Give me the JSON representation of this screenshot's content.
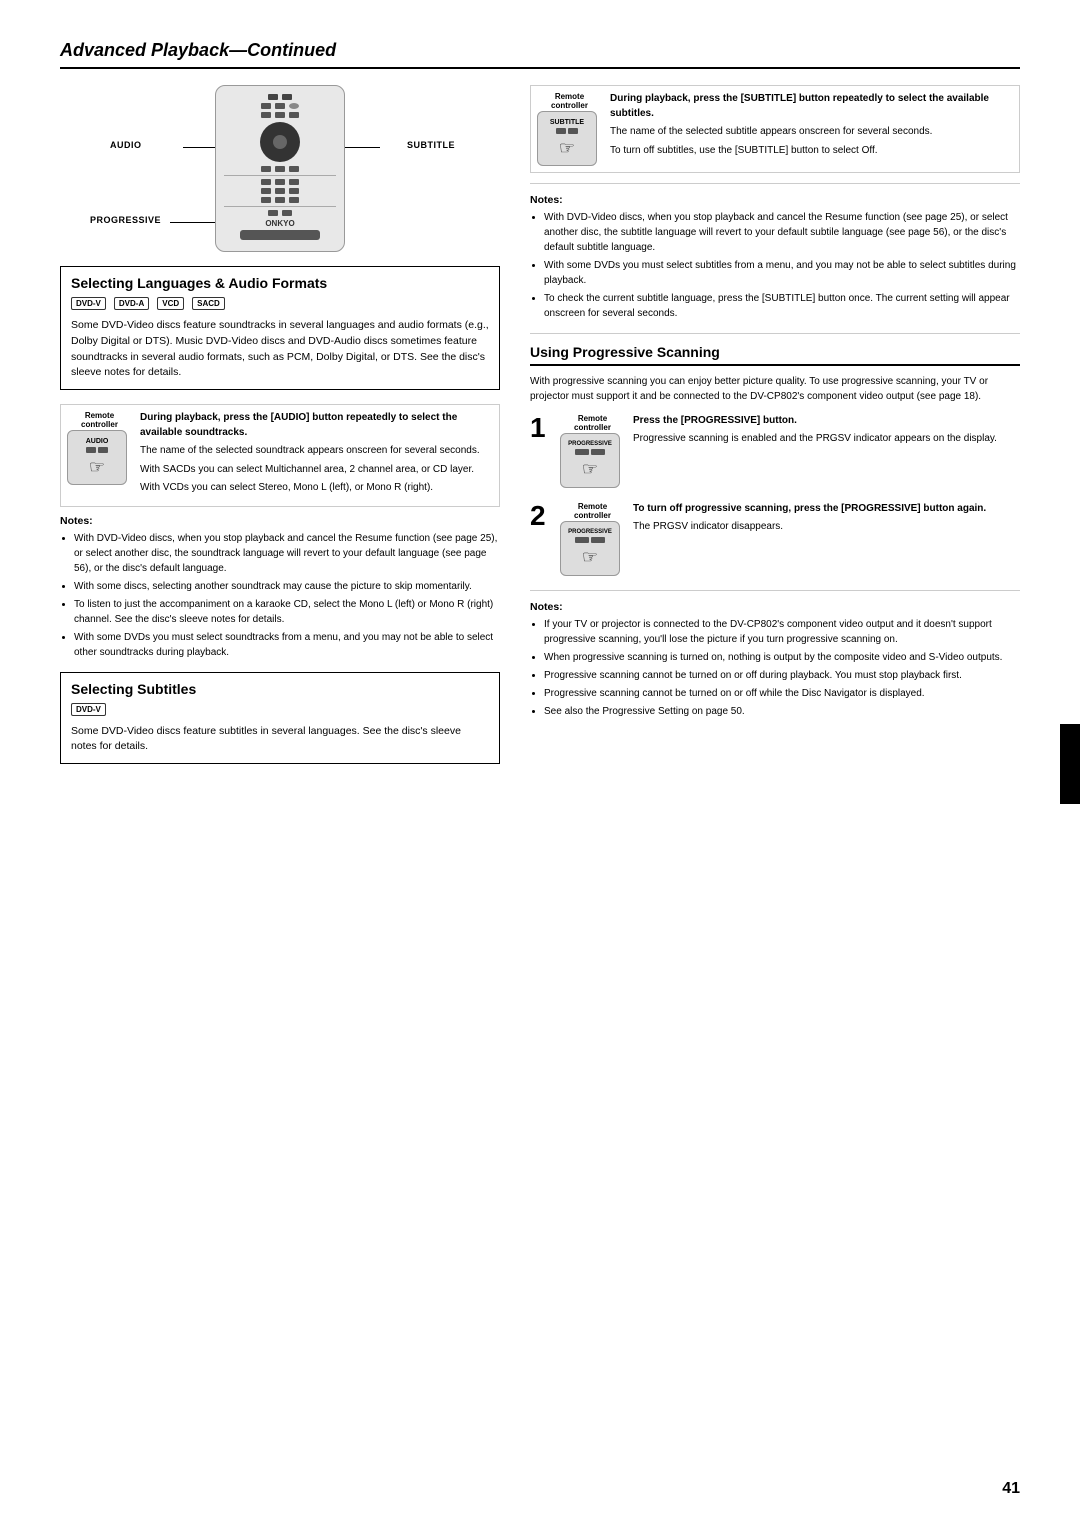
{
  "page": {
    "header": "Advanced Playback",
    "header_continued": "—Continued",
    "page_number": "41"
  },
  "remote_labels": {
    "audio": "AUDIO",
    "subtitle": "SUBTITLE",
    "progressive": "PROGRESSIVE"
  },
  "selecting_section": {
    "title": "Selecting Languages & Audio Formats",
    "disc_icons": [
      "DVD-V",
      "DVD-A",
      "VCD",
      "SACD"
    ],
    "intro_text": "Some DVD-Video discs feature soundtracks in several languages and audio formats (e.g., Dolby Digital or DTS). Music DVD-Video discs and DVD-Audio discs sometimes feature soundtracks in several audio formats, such as PCM, Dolby Digital, or DTS. See the disc's sleeve notes for details.",
    "audio_remote_block": {
      "label": "Remote controller",
      "btn_label": "AUDIO",
      "instruction_bold": "During playback, press the [AUDIO] button repeatedly to select the available soundtracks.",
      "detail_1": "The name of the selected soundtrack appears onscreen for several seconds.",
      "detail_2": "With SACDs you can select Multichannel area, 2 channel area, or CD layer.",
      "detail_3": "With VCDs you can select Stereo, Mono L (left), or Mono R (right)."
    }
  },
  "audio_notes": {
    "title": "Notes:",
    "items": [
      "With DVD-Video discs, when you stop playback and cancel the Resume function (see page 25), or select another disc, the soundtrack language will revert to your default language (see page 56), or the disc's default language.",
      "With some discs, selecting another soundtrack may cause the picture to skip momentarily.",
      "To listen to just the accompaniment on a karaoke CD, select the Mono L (left) or Mono R (right) channel. See the disc's sleeve notes for details.",
      "With some DVDs you must select soundtracks from a menu, and you may not be able to select other soundtracks during playback."
    ]
  },
  "selecting_subtitles": {
    "title": "Selecting Subtitles",
    "disc_icons": [
      "DVD-V"
    ],
    "intro_text": "Some DVD-Video discs feature subtitles in several languages. See the disc's sleeve notes for details."
  },
  "subtitle_remote_block": {
    "label": "Remote controller",
    "btn_label": "SUBTITLE",
    "instruction_bold": "During playback, press the [SUBTITLE] button repeatedly to select the available subtitles.",
    "detail_1": "The name of the selected subtitle appears onscreen for several seconds.",
    "detail_2": "To turn off subtitles, use the [SUBTITLE] button to select Off."
  },
  "subtitle_notes": {
    "title": "Notes:",
    "items": [
      "With DVD-Video discs, when you stop playback and cancel the Resume function (see page 25), or select another disc, the subtitle language will revert to your default subtile language (see page 56), or the disc's default subtitle language.",
      "With some DVDs you must select subtitles from a menu, and you may not be able to select subtitles during playback.",
      "To check the current subtitle language, press the [SUBTITLE] button once. The current setting will appear onscreen for several seconds."
    ]
  },
  "using_progressive": {
    "title": "Using Progressive Scanning",
    "intro_text": "With progressive scanning you can enjoy better picture quality. To use progressive scanning, your TV or projector must support it and be connected to the DV-CP802's component video output (see page 18).",
    "step1": {
      "number": "1",
      "label": "Remote controller",
      "btn_label": "PROGRESSIVE",
      "instruction_bold": "Press the [PROGRESSIVE] button.",
      "detail": "Progressive scanning is enabled and the PRGSV indicator appears on the display."
    },
    "step2": {
      "number": "2",
      "label": "Remote controller",
      "btn_label": "PROGRESSIVE",
      "instruction_bold": "To turn off progressive scanning, press the [PROGRESSIVE] button again.",
      "detail": "The PRGSV indicator disappears."
    }
  },
  "progressive_notes": {
    "title": "Notes:",
    "items": [
      "If your TV or projector is connected to the DV-CP802's component video output and it doesn't support progressive scanning, you'll lose the picture if you turn progressive scanning on.",
      "When progressive scanning is turned on, nothing is output by the composite video and S-Video outputs.",
      "Progressive scanning cannot be turned on or off during playback. You must stop playback first.",
      "Progressive scanning cannot be turned on or off while the Disc Navigator is displayed.",
      "See also the Progressive Setting on page 50."
    ]
  }
}
